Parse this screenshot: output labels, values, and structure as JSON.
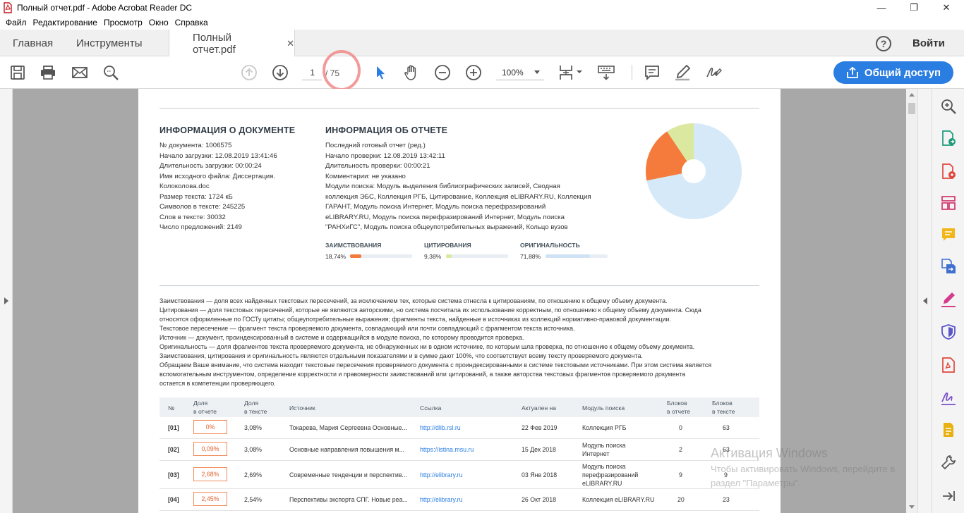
{
  "window": {
    "title": "Полный отчет.pdf - Adobe Acrobat Reader DC",
    "minimize": "—",
    "maximize": "❐",
    "close": "✕"
  },
  "menu": [
    "Файл",
    "Редактирование",
    "Просмотр",
    "Окно",
    "Справка"
  ],
  "tabs": {
    "home": "Главная",
    "tools": "Инструменты",
    "document": "Полный отчет.pdf",
    "close_glyph": "✕",
    "help": "?",
    "login": "Войти"
  },
  "toolbar": {
    "page_current": "1",
    "page_total": "/ 75",
    "zoom": "100%",
    "share": "Общий доступ"
  },
  "doc_info": {
    "title": "ИНФОРМАЦИЯ О ДОКУМЕНТЕ",
    "lines": [
      "№ документа: 1006575",
      "Начало загрузки: 12.08.2019 13:41:46",
      "Длительность загрузки: 00:00:24",
      "Имя исходного файла: Диссертация.",
      "Колоколова.doc",
      "Размер текста: 1724 кБ",
      "Символов в тексте: 245225",
      "Слов в тексте: 30032",
      "Число предложений: 2149"
    ]
  },
  "report_info": {
    "title": "ИНФОРМАЦИЯ ОБ ОТЧЕТЕ",
    "lines": [
      "Последний готовый отчет (ред.)",
      "Начало проверки: 12.08.2019 13:42:11",
      "Длительность проверки: 00:00:21",
      "Комментарии: не указано",
      "Модули поиска: Модуль выделения библиографических записей, Сводная",
      "коллекция ЭБС, Коллекция РГБ, Цитирование, Коллекция eLIBRARY.RU, Коллекция",
      "ГАРАНТ, Модуль поиска Интернет, Модуль поиска перефразирований",
      "eLIBRARY.RU, Модуль поиска перефразирований Интернет, Модуль поиска",
      "\"РАНХиГС\", Модуль поиска общеупотребительных выражений, Кольцо вузов"
    ]
  },
  "stats": [
    {
      "label": "ЗАИМСТВОВАНИЯ",
      "value": "18,74%",
      "fraction": 0.1874,
      "color": "#f47b3c"
    },
    {
      "label": "ЦИТИРОВАНИЯ",
      "value": "9,38%",
      "fraction": 0.0938,
      "color": "#dbe8a0"
    },
    {
      "label": "ОРИГИНАЛЬНОСТЬ",
      "value": "71,88%",
      "fraction": 0.7188,
      "color": "#d6e9f8"
    }
  ],
  "definitions": [
    "Заимствования — доля всех найденных текстовых пересечений, за исключением тех, которые система отнесла к цитированиям, по отношению к общему объему документа.",
    "Цитирования — доля текстовых пересечений, которые не являются авторскими, но система посчитала их использование корректным, по отношению к общему объему документа. Сюда",
    "относятся оформленные по ГОСТу цитаты; общеупотребительные выражения; фрагменты текста, найденные в источниках из коллекций нормативно-правовой документации.",
    "Текстовое пересечение — фрагмент текста проверяемого документа, совпадающий или почти совпадающий с фрагментом текста источника.",
    "Источник — документ, проиндексированный в системе и содержащийся в модуле поиска, по которому проводится проверка.",
    "Оригинальность — доля фрагментов текста проверяемого документа, не обнаруженных ни в одном источнике, по которым шла проверка, по отношению к общему объему документа.",
    "Заимствования, цитирования и оригинальность являются отдельными показателями и в сумме дают 100%, что соответствует всему тексту проверяемого документа.",
    "Обращаем Ваше внимание, что система находит текстовые пересечения проверяемого документа с проиндексированными в системе текстовыми источниками. При этом система является",
    "вспомогательным инструментом, определение корректности и правомерности заимствований или цитирований, а также авторства текстовых фрагментов проверяемого документа",
    "остается в компетенции проверяющего."
  ],
  "table": {
    "headers": {
      "num": "№",
      "share_report": [
        "Доля",
        "в отчете"
      ],
      "share_text": [
        "Доля",
        "в тексте"
      ],
      "source": "Источник",
      "link": "Ссылка",
      "actual": "Актуален на",
      "module": "Модуль поиска",
      "blocks_report": [
        "Блоков",
        "в отчете"
      ],
      "blocks_text": [
        "Блоков",
        "в тексте"
      ]
    },
    "rows": [
      {
        "num": "[01]",
        "share_report": "0%",
        "share_text": "3,08%",
        "source": "Токарева, Мария Сергеевна Основные...",
        "link": "http://dlib.rsl.ru",
        "actual": "22 Фев 2019",
        "module": [
          "Коллекция РГБ"
        ],
        "blocks_report": "0",
        "blocks_text": "63"
      },
      {
        "num": "[02]",
        "share_report": "0,09%",
        "share_text": "3,08%",
        "source": "Основные направления повышения м...",
        "link": "https://istina.msu.ru",
        "actual": "15 Дек 2018",
        "module": [
          "Модуль поиска",
          "Интернет"
        ],
        "blocks_report": "2",
        "blocks_text": "63"
      },
      {
        "num": "[03]",
        "share_report": "2,68%",
        "share_text": "2,69%",
        "source": "Современные тенденции и перспектив...",
        "link": "http://elibrary.ru",
        "actual": "03 Янв 2018",
        "module": [
          "Модуль поиска",
          "перефразирований",
          "eLIBRARY.RU"
        ],
        "blocks_report": "9",
        "blocks_text": "9"
      },
      {
        "num": "[04]",
        "share_report": "2,45%",
        "share_text": "2,54%",
        "source": "Перспективы экспорта СПГ. Новые реа...",
        "link": "http://elibrary.ru",
        "actual": "26 Окт 2018",
        "module": [
          "Коллекция eLIBRARY.RU"
        ],
        "blocks_report": "20",
        "blocks_text": "23"
      }
    ]
  },
  "watermark": {
    "title": "Активация Windows",
    "line1": "Чтобы активировать Windows, перейдите в",
    "line2": "раздел \"Параметры\"."
  },
  "icons": {
    "toolbar": [
      "save-icon",
      "print-icon",
      "email-icon",
      "search-icon",
      "page-up-icon",
      "page-down-icon",
      "select-cursor-icon",
      "hand-icon",
      "zoom-out-icon",
      "zoom-in-icon",
      "page-fit-icon",
      "keyboard-icon",
      "comment-icon",
      "highlight-pen-icon",
      "sign-icon",
      "share-upload-icon"
    ],
    "right_panel": [
      "zoom-search-icon",
      "export-pdf-icon",
      "create-pdf-icon",
      "organize-pages-icon",
      "comment-icon",
      "combine-files-icon",
      "fill-sign-icon",
      "protect-icon",
      "pdf-icon",
      "sign-pen-icon",
      "send-files-icon",
      "tools-icon",
      "next-arrow-icon"
    ]
  },
  "colors": {
    "accent": "#2a7de1",
    "borrowed": "#f47b3c",
    "cited": "#dbe8a0",
    "original": "#d6e9f8"
  }
}
